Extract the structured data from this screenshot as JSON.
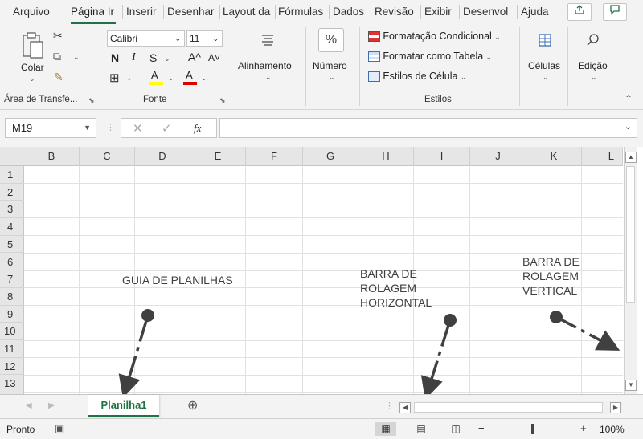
{
  "ribbon_tabs": [
    {
      "label": "Arquivo"
    },
    {
      "label": "Página Ir"
    },
    {
      "label": "Inserir"
    },
    {
      "label": "Desenhar"
    },
    {
      "label": "Layout da"
    },
    {
      "label": "Fórmulas"
    },
    {
      "label": "Dados"
    },
    {
      "label": "Revisão"
    },
    {
      "label": "Exibir"
    },
    {
      "label": "Desenvol"
    },
    {
      "label": "Ajuda"
    }
  ],
  "accent_color": "#217346",
  "clipboard": {
    "paste_label": "Colar",
    "group_label": "Área de Transfe..."
  },
  "font": {
    "name": "Calibri",
    "size": "11",
    "bold": "N",
    "italic": "I",
    "underline": "S",
    "grow": "A^",
    "shrink": "A˅",
    "fill_glyph": "A",
    "color_glyph": "A",
    "group_label": "Fonte"
  },
  "alignment": {
    "label": "Alinhamento"
  },
  "number": {
    "label": "Número",
    "symbol": "%"
  },
  "styles": {
    "conditional": "Formatação Condicional",
    "table": "Formatar como Tabela",
    "cell": "Estilos de Célula",
    "group_label": "Estilos"
  },
  "cells": {
    "label": "Células"
  },
  "editing": {
    "label": "Edição"
  },
  "formula_bar": {
    "name_box": "M19",
    "fx": "fx",
    "value": ""
  },
  "columns": [
    "B",
    "C",
    "D",
    "E",
    "F",
    "G",
    "H",
    "I",
    "J",
    "K",
    "L"
  ],
  "rows": [
    "1",
    "2",
    "3",
    "4",
    "5",
    "6",
    "7",
    "8",
    "9",
    "10",
    "11",
    "12",
    "13"
  ],
  "annotations": {
    "sheet_tabs": "GUIA DE PLANILHAS",
    "hscroll": [
      "BARRA DE",
      "ROLAGEM",
      "HORIZONTAL"
    ],
    "vscroll": [
      "BARRA DE",
      "ROLAGEM",
      "VERTICAL"
    ]
  },
  "sheet_tab": "Planilha1",
  "status": {
    "ready": "Pronto",
    "zoom": "100%",
    "zoom_minus": "−",
    "zoom_plus": "+"
  }
}
